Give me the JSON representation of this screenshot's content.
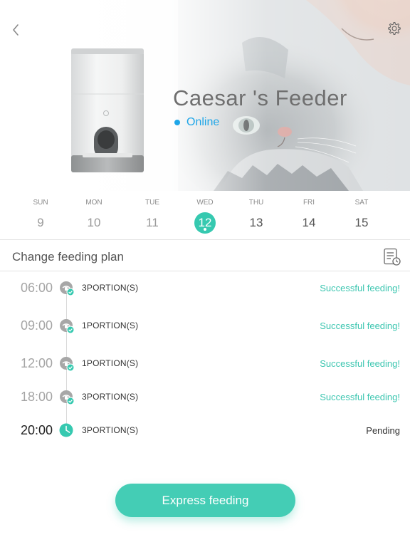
{
  "header": {
    "back_icon": "chevron-left-icon",
    "settings_icon": "gear-icon"
  },
  "device": {
    "name": "Caesar 's Feeder",
    "status": "Online",
    "status_color": "#1ea6e8"
  },
  "week": [
    {
      "day": "SUN",
      "date": "9",
      "state": "past"
    },
    {
      "day": "MON",
      "date": "10",
      "state": "past"
    },
    {
      "day": "TUE",
      "date": "11",
      "state": "past"
    },
    {
      "day": "WED",
      "date": "12",
      "state": "selected"
    },
    {
      "day": "THU",
      "date": "13",
      "state": "future"
    },
    {
      "day": "FRI",
      "date": "14",
      "state": "future"
    },
    {
      "day": "SAT",
      "date": "15",
      "state": "future"
    }
  ],
  "plan": {
    "title": "Change feeding plan",
    "icon": "schedule-list-icon"
  },
  "feedings": [
    {
      "time": "06:00",
      "portion": "3PORTION(S)",
      "status": "Successful feeding!",
      "state": "done"
    },
    {
      "time": "09:00",
      "portion": "1PORTION(S)",
      "status": "Successful feeding!",
      "state": "done"
    },
    {
      "time": "12:00",
      "portion": "1PORTION(S)",
      "status": "Successful feeding!",
      "state": "done"
    },
    {
      "time": "18:00",
      "portion": "3PORTION(S)",
      "status": "Successful feeding!",
      "state": "done"
    },
    {
      "time": "20:00",
      "portion": "3PORTION(S)",
      "status": "Pending",
      "state": "pending"
    }
  ],
  "express": {
    "label": "Express feeding"
  },
  "colors": {
    "accent": "#44cdb5",
    "success_text": "#3cc6b0",
    "online": "#1ea6e8"
  }
}
